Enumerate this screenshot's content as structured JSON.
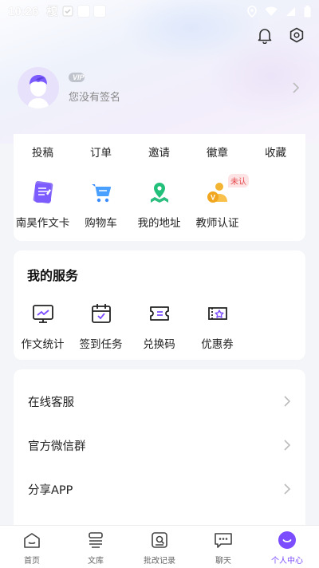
{
  "status_bar": {
    "time": "10:26",
    "app_glyph": "榎"
  },
  "profile": {
    "vip_label": "VIP",
    "signature": "您没有签名"
  },
  "stats": [
    {
      "label": "投稿"
    },
    {
      "label": "订单"
    },
    {
      "label": "邀请"
    },
    {
      "label": "徽章"
    },
    {
      "label": "收藏"
    }
  ],
  "features": [
    {
      "label": "南昊作文卡",
      "icon": "essay-card-icon"
    },
    {
      "label": "购物车",
      "icon": "cart-icon"
    },
    {
      "label": "我的地址",
      "icon": "location-icon"
    },
    {
      "label": "教师认证",
      "icon": "teacher-cert-icon",
      "badge": "未认"
    }
  ],
  "services": {
    "title": "我的服务",
    "items": [
      {
        "label": "作文统计",
        "icon": "stats-chart-icon"
      },
      {
        "label": "签到任务",
        "icon": "calendar-check-icon"
      },
      {
        "label": "兑换码",
        "icon": "ticket-icon"
      },
      {
        "label": "优惠券",
        "icon": "coupon-icon"
      }
    ]
  },
  "list": [
    {
      "label": "在线客服"
    },
    {
      "label": "官方微信群"
    },
    {
      "label": "分享APP"
    }
  ],
  "tabs": [
    {
      "label": "首页",
      "icon": "home-icon"
    },
    {
      "label": "文库",
      "icon": "library-icon"
    },
    {
      "label": "批改记录",
      "icon": "correction-record-icon"
    },
    {
      "label": "聊天",
      "icon": "chat-icon"
    },
    {
      "label": "个人中心",
      "icon": "profile-center-icon",
      "active": true
    }
  ],
  "colors": {
    "accent": "#7c4dff",
    "badge_red": "#e5484d",
    "text_gray": "#888888"
  }
}
